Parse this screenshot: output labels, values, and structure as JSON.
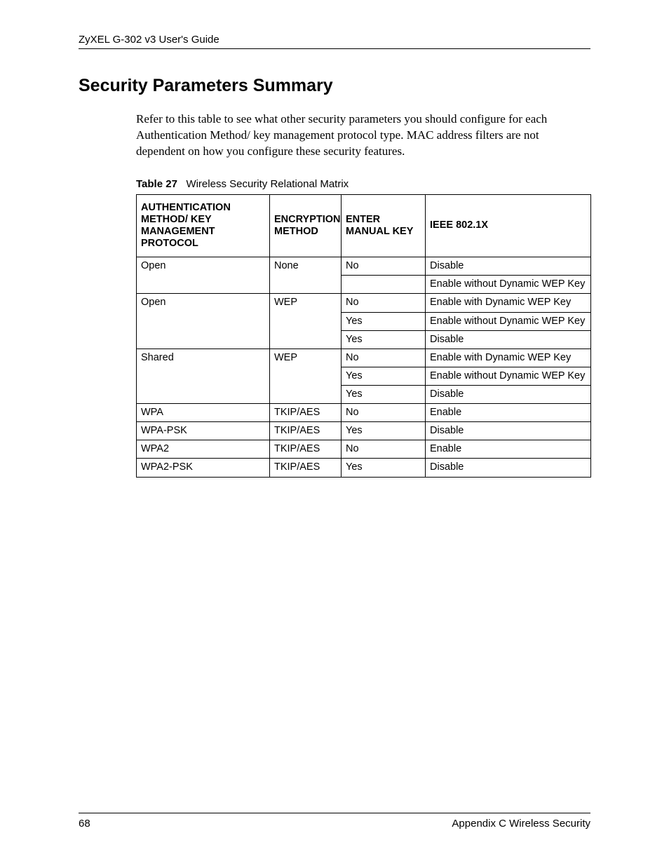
{
  "header": {
    "guide_title": "ZyXEL G-302 v3 User's Guide"
  },
  "section": {
    "title": "Security Parameters Summary",
    "intro": "Refer to this table to see what other security parameters you should configure for each Authentication Method/ key management protocol type. MAC address filters are not dependent on how you configure these security features."
  },
  "table": {
    "caption_label": "Table 27",
    "caption_text": "Wireless Security Relational Matrix",
    "headers": {
      "auth": "AUTHENTICATION METHOD/ KEY MANAGEMENT PROTOCOL",
      "enc": "ENCRYPTION METHOD",
      "manual": "ENTER MANUAL KEY",
      "ieee": "IEEE 802.1X"
    },
    "groups": [
      {
        "auth": "Open",
        "enc": "None",
        "rows": [
          {
            "manual": "No",
            "ieee": "Disable"
          },
          {
            "manual": "",
            "ieee": "Enable without Dynamic WEP Key"
          }
        ]
      },
      {
        "auth": "Open",
        "enc": "WEP",
        "rows": [
          {
            "manual": "No",
            "ieee": "Enable with Dynamic WEP Key"
          },
          {
            "manual": "Yes",
            "ieee": "Enable without Dynamic WEP Key"
          },
          {
            "manual": "Yes",
            "ieee": "Disable"
          }
        ]
      },
      {
        "auth": "Shared",
        "enc": "WEP",
        "rows": [
          {
            "manual": "No",
            "ieee": "Enable with Dynamic WEP Key"
          },
          {
            "manual": "Yes",
            "ieee": "Enable without Dynamic WEP Key"
          },
          {
            "manual": "Yes",
            "ieee": "Disable"
          }
        ]
      },
      {
        "auth": "WPA",
        "enc": "TKIP/AES",
        "rows": [
          {
            "manual": "No",
            "ieee": "Enable"
          }
        ]
      },
      {
        "auth": "WPA-PSK",
        "enc": "TKIP/AES",
        "rows": [
          {
            "manual": "Yes",
            "ieee": "Disable"
          }
        ]
      },
      {
        "auth": "WPA2",
        "enc": "TKIP/AES",
        "rows": [
          {
            "manual": "No",
            "ieee": "Enable"
          }
        ]
      },
      {
        "auth": "WPA2-PSK",
        "enc": "TKIP/AES",
        "rows": [
          {
            "manual": "Yes",
            "ieee": "Disable"
          }
        ]
      }
    ]
  },
  "footer": {
    "page_number": "68",
    "appendix": "Appendix C Wireless Security"
  }
}
